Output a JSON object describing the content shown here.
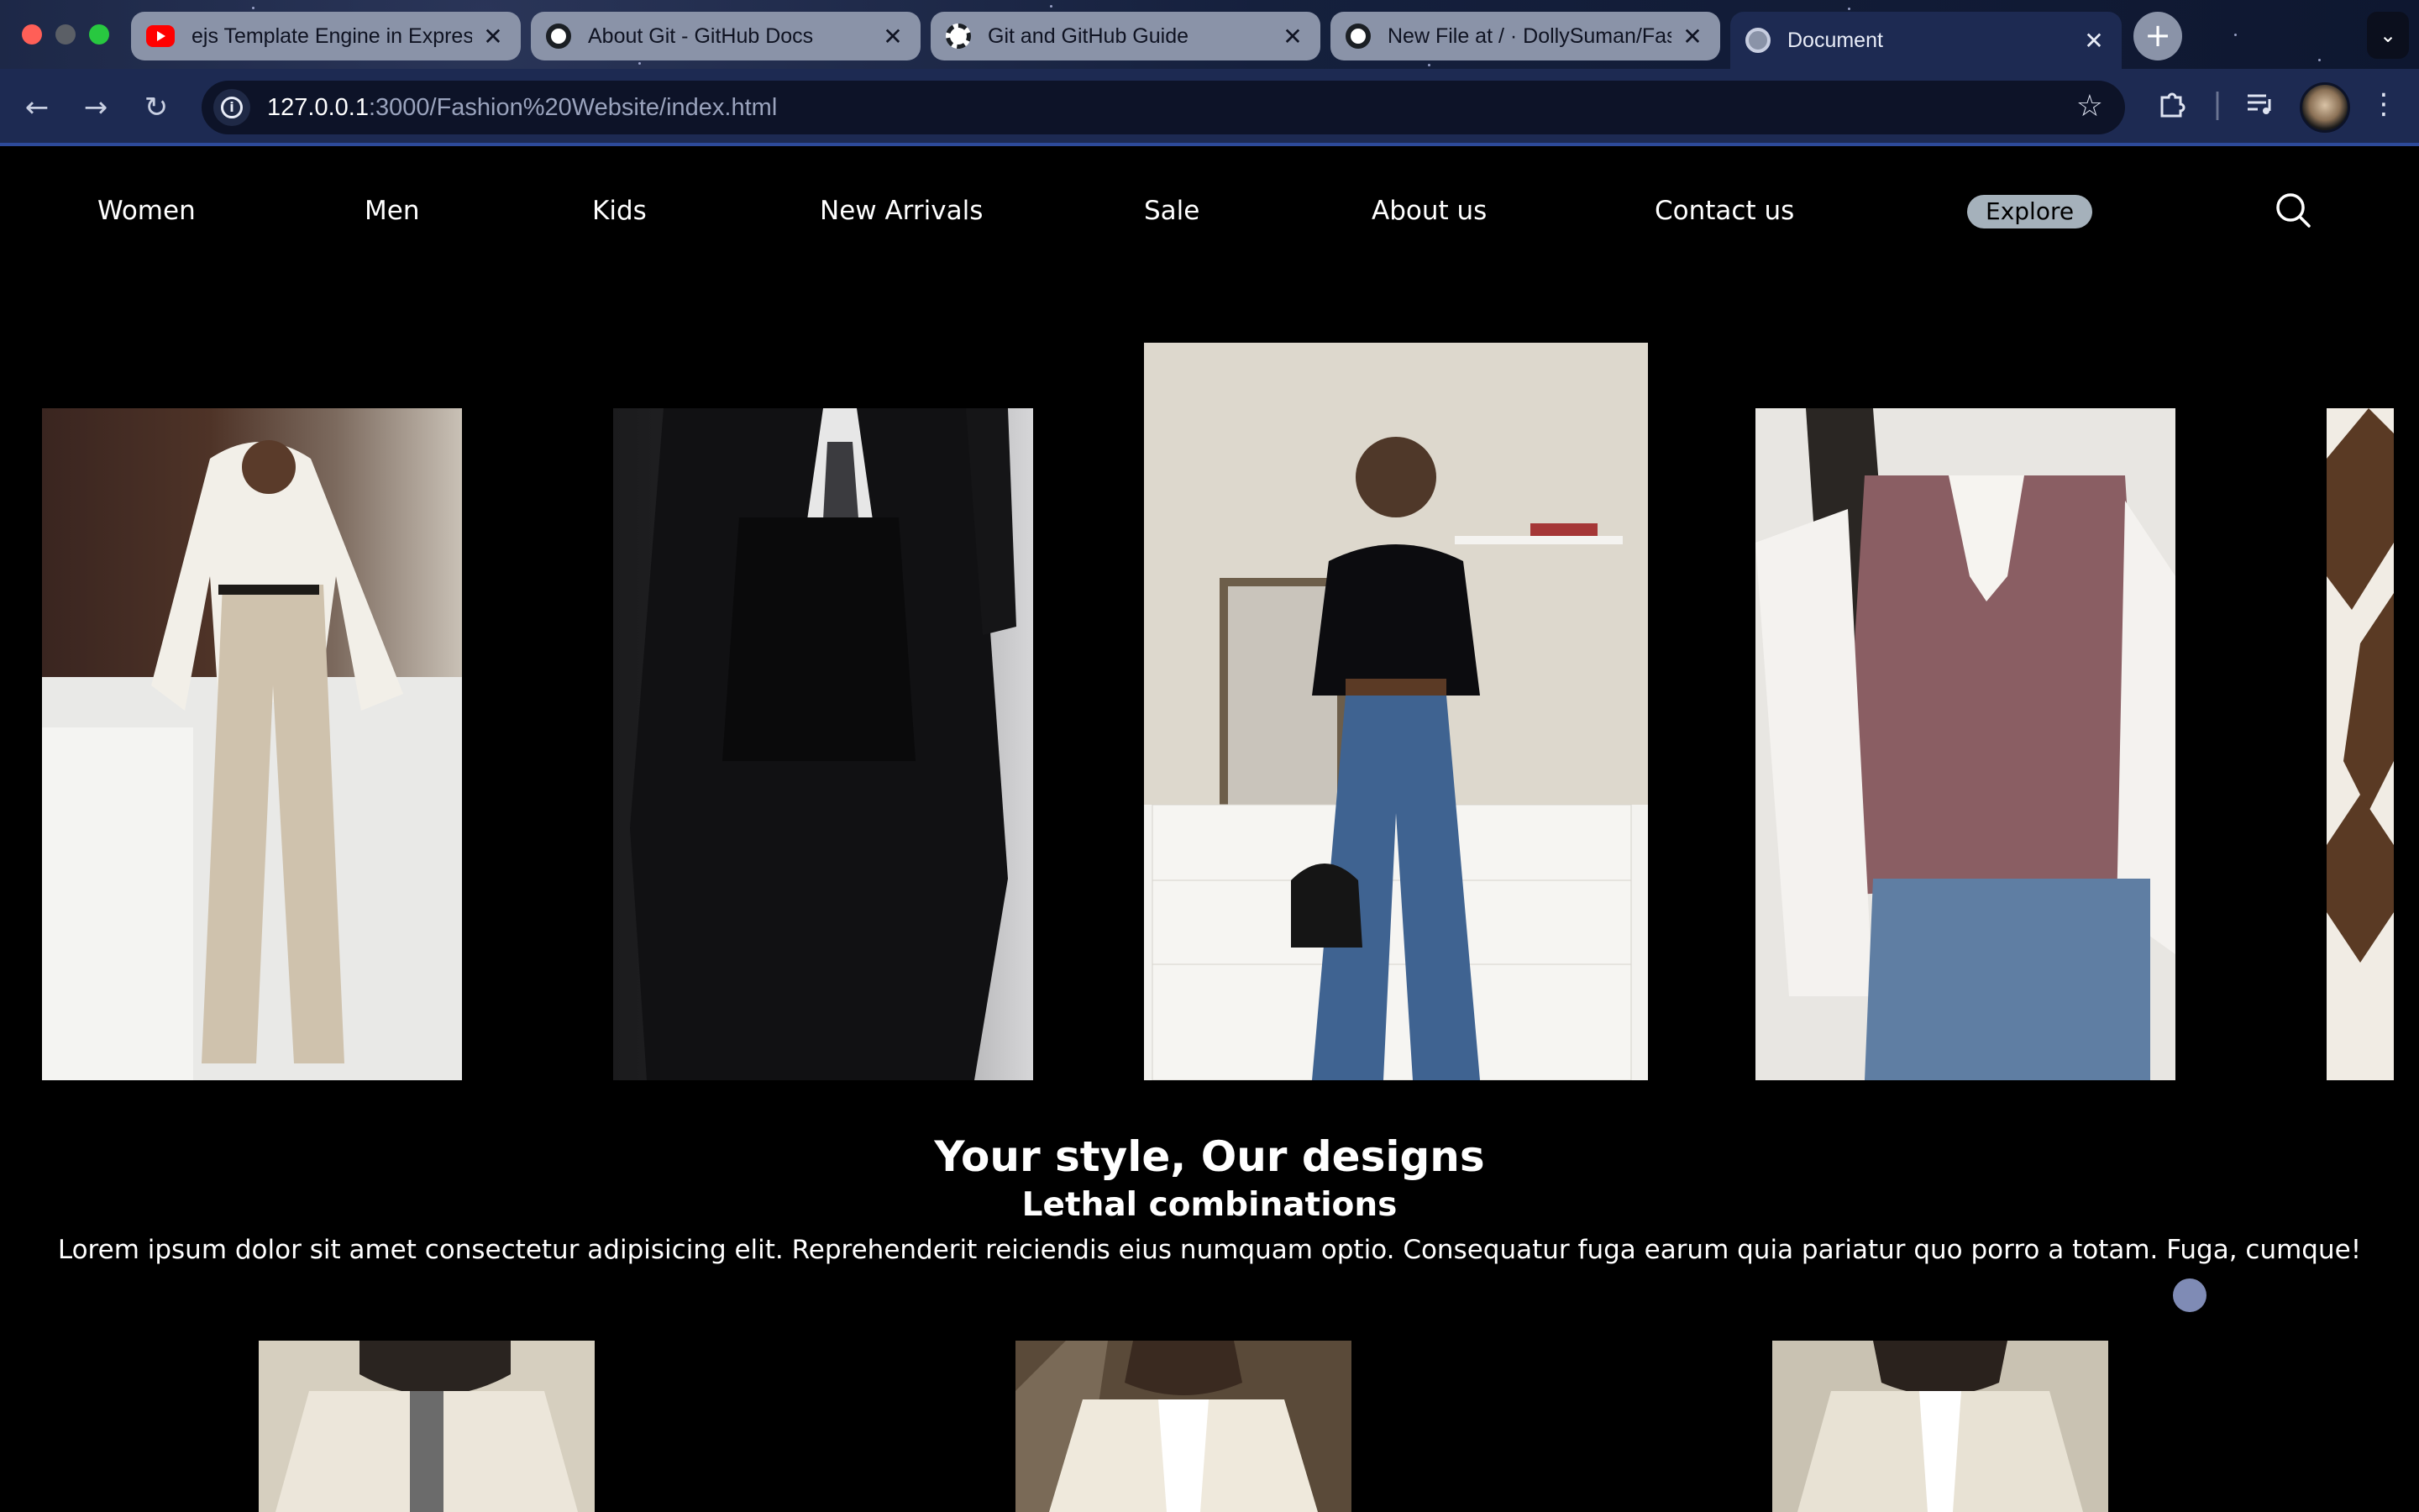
{
  "browser": {
    "tabs": [
      {
        "title": "ejs Template Engine in Express",
        "favicon": "youtube-icon",
        "active": false
      },
      {
        "title": "About Git - GitHub Docs",
        "favicon": "github-icon",
        "active": false
      },
      {
        "title": "Git and GitHub Guide",
        "favicon": "openai-icon",
        "active": false
      },
      {
        "title": "New File at / · DollySuman/Fashion",
        "favicon": "github-icon",
        "active": false
      },
      {
        "title": "Document",
        "favicon": "globe-icon",
        "active": true
      }
    ],
    "url_host": "127.0.0.1",
    "url_path": ":3000/Fashion%20Website/index.html"
  },
  "nav": {
    "items": [
      "Women",
      "Men",
      "Kids",
      "New Arrivals",
      "Sale",
      "About us",
      "Contact us"
    ],
    "explore_label": "Explore"
  },
  "hero": {
    "title": "Your style, Our designs",
    "subtitle": "Lethal combinations",
    "text": "Lorem ipsum dolor sit amet consectetur adipisicing elit. Reprehenderit reiciendis eius numquam optio. Consequatur fuga earum quia pariatur quo porro a totam. Fuga, cumque!"
  },
  "colors": {
    "page_bg": "#000000",
    "explore_bg": "#a5b1bb",
    "browser_frame": "#1d2a52"
  }
}
